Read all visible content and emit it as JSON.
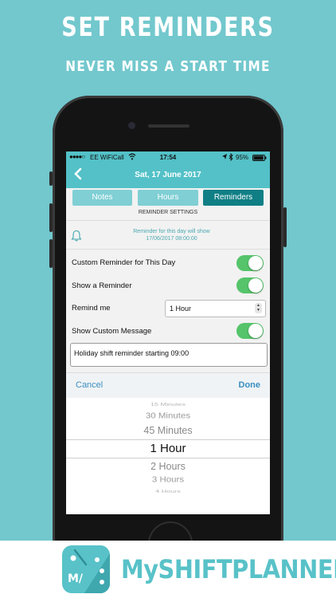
{
  "promo": {
    "title": "SET REMINDERS",
    "subtitle": "NEVER MISS A START TIME"
  },
  "status_bar": {
    "signal": "●●●●○",
    "carrier": "EE WiFiCall",
    "wifi_icon": "wifi-icon",
    "time": "17:54",
    "location_icon": "location-arrow-icon",
    "bluetooth_icon": "bluetooth-icon",
    "battery_percent": "95%",
    "battery_level": 0.95
  },
  "nav": {
    "back_icon": "chevron-left-icon",
    "title": "Sat, 17 June 2017"
  },
  "tabs": [
    {
      "label": "Notes",
      "active": false
    },
    {
      "label": "Hours",
      "active": false
    },
    {
      "label": "Reminders",
      "active": true
    }
  ],
  "section_label": "REMINDER SETTINGS",
  "reminder_info": {
    "icon": "bell-icon",
    "line1": "Reminder for this day will show",
    "line2": "17/06/2017 08:00:00"
  },
  "settings": {
    "custom_reminder": {
      "label": "Custom Reminder for This Day",
      "on": true
    },
    "show_reminder": {
      "label": "Show a Reminder",
      "on": true
    },
    "remind_me": {
      "label": "Remind me",
      "value": "1 Hour"
    },
    "show_custom_message": {
      "label": "Show Custom Message",
      "on": true
    },
    "custom_message": "Holiday shift reminder starting 09:00"
  },
  "picker": {
    "cancel_label": "Cancel",
    "done_label": "Done",
    "options": [
      "15 Minutes",
      "30 Minutes",
      "45 Minutes",
      "1 Hour",
      "2 Hours",
      "3 Hours",
      "4 Hours"
    ],
    "selected": "1 Hour"
  },
  "brand": {
    "logo_text": "M/",
    "name": "MySHIFTPLANNER"
  },
  "colors": {
    "background": "#72c8cd",
    "accent": "#53c1c7",
    "active_tab": "#0f7f85",
    "inactive_tab": "#7fcfd4",
    "switch_on": "#55c46a",
    "link": "#3c8fc1"
  }
}
